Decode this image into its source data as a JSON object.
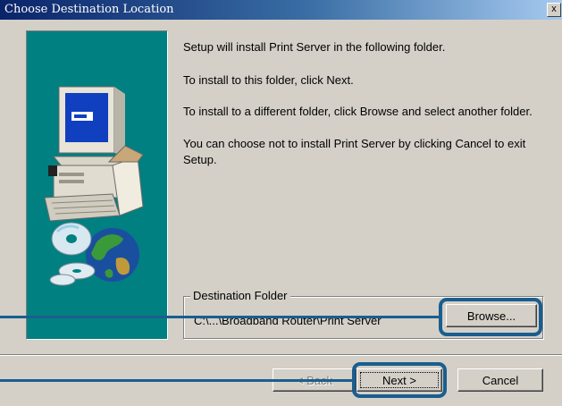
{
  "window": {
    "title": "Choose Destination Location",
    "close_glyph": "x"
  },
  "messages": {
    "line1": "Setup will install Print Server in the following folder.",
    "line2": "To install to this folder, click Next.",
    "line3": "To install to a different folder, click Browse and select another folder.",
    "line4a": "You can choose not to install Print Server by clicking Cancel to exit",
    "line4b": "Setup."
  },
  "destination": {
    "legend": "Destination Folder",
    "path": "C:\\...\\Broadband Router\\Print Server",
    "browse_label": "Browse..."
  },
  "buttons": {
    "back_label": "< Back",
    "next_label": "Next >",
    "cancel_label": "Cancel"
  },
  "colors": {
    "panel": "#008080",
    "highlight": "#1a5e8f",
    "title_start": "#0a246a"
  },
  "icons": {
    "panel_art": "computer-globe-cd-illustration"
  }
}
